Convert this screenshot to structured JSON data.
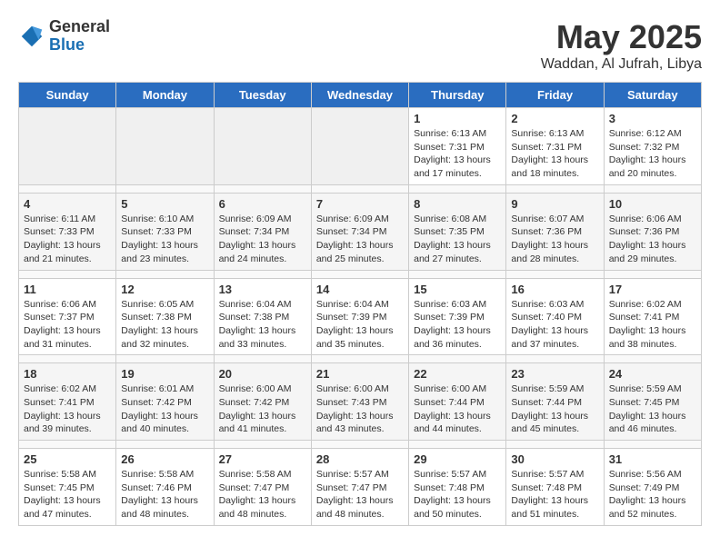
{
  "header": {
    "logo_general": "General",
    "logo_blue": "Blue",
    "month": "May 2025",
    "location": "Waddan, Al Jufrah, Libya"
  },
  "days_of_week": [
    "Sunday",
    "Monday",
    "Tuesday",
    "Wednesday",
    "Thursday",
    "Friday",
    "Saturday"
  ],
  "weeks": [
    [
      {
        "day": "",
        "info": ""
      },
      {
        "day": "",
        "info": ""
      },
      {
        "day": "",
        "info": ""
      },
      {
        "day": "",
        "info": ""
      },
      {
        "day": "1",
        "info": "Sunrise: 6:13 AM\nSunset: 7:31 PM\nDaylight: 13 hours\nand 17 minutes."
      },
      {
        "day": "2",
        "info": "Sunrise: 6:13 AM\nSunset: 7:31 PM\nDaylight: 13 hours\nand 18 minutes."
      },
      {
        "day": "3",
        "info": "Sunrise: 6:12 AM\nSunset: 7:32 PM\nDaylight: 13 hours\nand 20 minutes."
      }
    ],
    [
      {
        "day": "4",
        "info": "Sunrise: 6:11 AM\nSunset: 7:33 PM\nDaylight: 13 hours\nand 21 minutes."
      },
      {
        "day": "5",
        "info": "Sunrise: 6:10 AM\nSunset: 7:33 PM\nDaylight: 13 hours\nand 23 minutes."
      },
      {
        "day": "6",
        "info": "Sunrise: 6:09 AM\nSunset: 7:34 PM\nDaylight: 13 hours\nand 24 minutes."
      },
      {
        "day": "7",
        "info": "Sunrise: 6:09 AM\nSunset: 7:34 PM\nDaylight: 13 hours\nand 25 minutes."
      },
      {
        "day": "8",
        "info": "Sunrise: 6:08 AM\nSunset: 7:35 PM\nDaylight: 13 hours\nand 27 minutes."
      },
      {
        "day": "9",
        "info": "Sunrise: 6:07 AM\nSunset: 7:36 PM\nDaylight: 13 hours\nand 28 minutes."
      },
      {
        "day": "10",
        "info": "Sunrise: 6:06 AM\nSunset: 7:36 PM\nDaylight: 13 hours\nand 29 minutes."
      }
    ],
    [
      {
        "day": "11",
        "info": "Sunrise: 6:06 AM\nSunset: 7:37 PM\nDaylight: 13 hours\nand 31 minutes."
      },
      {
        "day": "12",
        "info": "Sunrise: 6:05 AM\nSunset: 7:38 PM\nDaylight: 13 hours\nand 32 minutes."
      },
      {
        "day": "13",
        "info": "Sunrise: 6:04 AM\nSunset: 7:38 PM\nDaylight: 13 hours\nand 33 minutes."
      },
      {
        "day": "14",
        "info": "Sunrise: 6:04 AM\nSunset: 7:39 PM\nDaylight: 13 hours\nand 35 minutes."
      },
      {
        "day": "15",
        "info": "Sunrise: 6:03 AM\nSunset: 7:39 PM\nDaylight: 13 hours\nand 36 minutes."
      },
      {
        "day": "16",
        "info": "Sunrise: 6:03 AM\nSunset: 7:40 PM\nDaylight: 13 hours\nand 37 minutes."
      },
      {
        "day": "17",
        "info": "Sunrise: 6:02 AM\nSunset: 7:41 PM\nDaylight: 13 hours\nand 38 minutes."
      }
    ],
    [
      {
        "day": "18",
        "info": "Sunrise: 6:02 AM\nSunset: 7:41 PM\nDaylight: 13 hours\nand 39 minutes."
      },
      {
        "day": "19",
        "info": "Sunrise: 6:01 AM\nSunset: 7:42 PM\nDaylight: 13 hours\nand 40 minutes."
      },
      {
        "day": "20",
        "info": "Sunrise: 6:00 AM\nSunset: 7:42 PM\nDaylight: 13 hours\nand 41 minutes."
      },
      {
        "day": "21",
        "info": "Sunrise: 6:00 AM\nSunset: 7:43 PM\nDaylight: 13 hours\nand 43 minutes."
      },
      {
        "day": "22",
        "info": "Sunrise: 6:00 AM\nSunset: 7:44 PM\nDaylight: 13 hours\nand 44 minutes."
      },
      {
        "day": "23",
        "info": "Sunrise: 5:59 AM\nSunset: 7:44 PM\nDaylight: 13 hours\nand 45 minutes."
      },
      {
        "day": "24",
        "info": "Sunrise: 5:59 AM\nSunset: 7:45 PM\nDaylight: 13 hours\nand 46 minutes."
      }
    ],
    [
      {
        "day": "25",
        "info": "Sunrise: 5:58 AM\nSunset: 7:45 PM\nDaylight: 13 hours\nand 47 minutes."
      },
      {
        "day": "26",
        "info": "Sunrise: 5:58 AM\nSunset: 7:46 PM\nDaylight: 13 hours\nand 48 minutes."
      },
      {
        "day": "27",
        "info": "Sunrise: 5:58 AM\nSunset: 7:47 PM\nDaylight: 13 hours\nand 48 minutes."
      },
      {
        "day": "28",
        "info": "Sunrise: 5:57 AM\nSunset: 7:47 PM\nDaylight: 13 hours\nand 48 minutes."
      },
      {
        "day": "29",
        "info": "Sunrise: 5:57 AM\nSunset: 7:48 PM\nDaylight: 13 hours\nand 50 minutes."
      },
      {
        "day": "30",
        "info": "Sunrise: 5:57 AM\nSunset: 7:48 PM\nDaylight: 13 hours\nand 51 minutes."
      },
      {
        "day": "31",
        "info": "Sunrise: 5:56 AM\nSunset: 7:49 PM\nDaylight: 13 hours\nand 52 minutes."
      }
    ]
  ]
}
